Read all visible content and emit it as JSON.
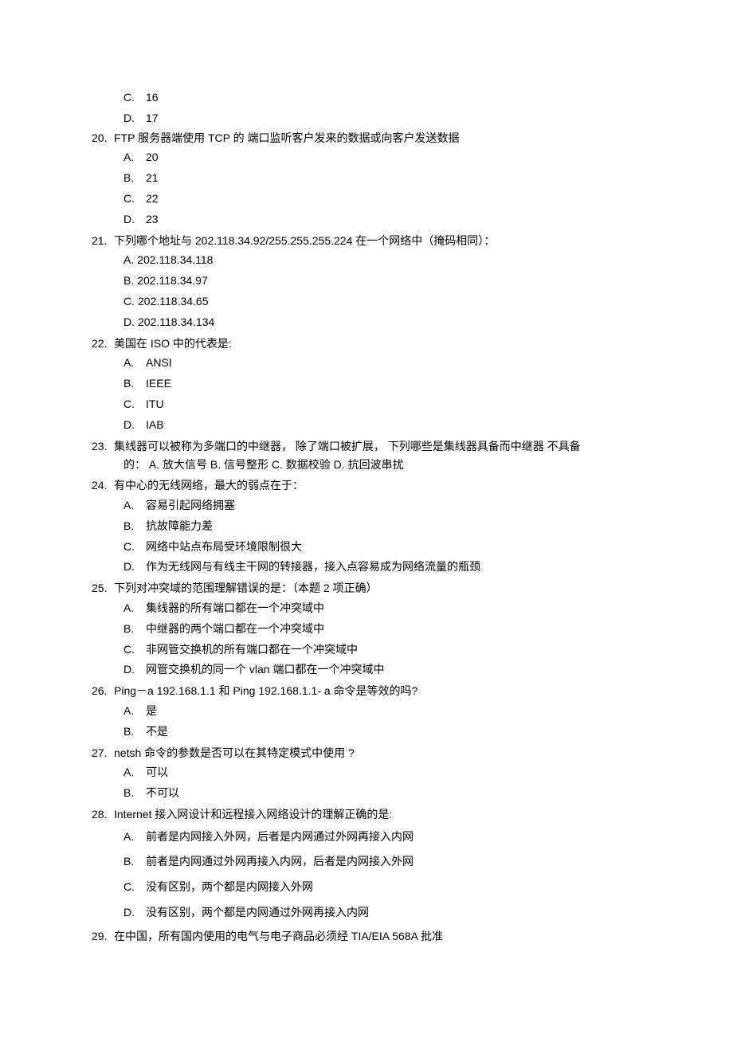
{
  "orphan_options": [
    {
      "label": "C.",
      "text": "16"
    },
    {
      "label": "D.",
      "text": "17"
    }
  ],
  "questions": [
    {
      "num": "20.",
      "text": "FTP 服务器端使用 TCP 的 端口监听客户发来的数据或向客户发送数据",
      "options": [
        {
          "label": "A.",
          "text": "20"
        },
        {
          "label": "B.",
          "text": "21"
        },
        {
          "label": "C.",
          "text": "22"
        },
        {
          "label": "D.",
          "text": "23"
        }
      ]
    },
    {
      "num": "21.",
      "text": "下列哪个地址与 202.118.34.92/255.255.255.224 在一个网络中（掩码相同）：",
      "tight": true,
      "options": [
        {
          "label": "A.",
          "text": "202.118.34.118"
        },
        {
          "label": "B.",
          "text": "202.118.34.97"
        },
        {
          "label": "C.",
          "text": "202.118.34.65"
        },
        {
          "label": "D.",
          "text": "202.118.34.134"
        }
      ]
    },
    {
      "num": "22.",
      "text": "美国在 ISO 中的代表是:",
      "options": [
        {
          "label": "A.",
          "text": "ANSI"
        },
        {
          "label": "B.",
          "text": "IEEE"
        },
        {
          "label": "C.",
          "text": "ITU"
        },
        {
          "label": "D.",
          "text": "IAB"
        }
      ]
    },
    {
      "num": "23.",
      "text": "集线器可以被称为多端口的中继器， 除了端口被扩展， 下列哪些是集线器具备而中继器 不具备",
      "continuation": "的： A. 放大信号 B. 信号整形 C. 数据校验 D. 抗回波串扰",
      "options": []
    },
    {
      "num": "24.",
      "text": "有中心的无线网络，最大的弱点在于：",
      "options": [
        {
          "label": "A.",
          "text": "容易引起网络拥塞"
        },
        {
          "label": "B.",
          "text": "抗故障能力差"
        },
        {
          "label": "C.",
          "text": "网络中站点布局受环境限制很大"
        },
        {
          "label": "D.",
          "text": "作为无线网与有线主干网的转接器，接入点容易成为网络流量的瓶颈"
        }
      ]
    },
    {
      "num": "25.",
      "text": "下列对冲突域的范围理解错误的是：（本题 2 项正确）",
      "options": [
        {
          "label": "A.",
          "text": "集线器的所有端口都在一个冲突域中"
        },
        {
          "label": "B.",
          "text": "中继器的两个端口都在一个冲突域中"
        },
        {
          "label": "C.",
          "text": "非网管交换机的所有端口都在一个冲突域中"
        },
        {
          "label": "D.",
          "text": "网管交换机的同一个 vlan 端口都在一个冲突域中"
        }
      ]
    },
    {
      "num": "26.",
      "text": "Ping－a 192.168.1.1 和 Ping 192.168.1.1-  a 命令是等效的吗?",
      "options": [
        {
          "label": "A.",
          "text": "是"
        },
        {
          "label": "B.",
          "text": "不是"
        }
      ]
    },
    {
      "num": "27.",
      "text": "netsh 命令的参数是否可以在其特定模式中使用 ?",
      "options": [
        {
          "label": "A.",
          "text": "可以"
        },
        {
          "label": "B.",
          "text": "不可以"
        }
      ]
    },
    {
      "num": "28.",
      "text": "Internet 接入网设计和远程接入网络设计的理解正确的是:",
      "spaced": true,
      "options": [
        {
          "label": "A.",
          "text": "前者是内网接入外网，后者是内网通过外网再接入内网"
        },
        {
          "label": "B.",
          "text": "前者是内网通过外网再接入内网，后者是内网接入外网"
        },
        {
          "label": "C.",
          "text": "没有区别，两个都是内网接入外网"
        },
        {
          "label": "D.",
          "text": "没有区别，两个都是内网通过外网再接入内网"
        }
      ]
    },
    {
      "num": "29.",
      "text": "在中国，所有国内使用的电气与电子商品必须经 TIA/EIA 568A 批准",
      "options": []
    }
  ]
}
